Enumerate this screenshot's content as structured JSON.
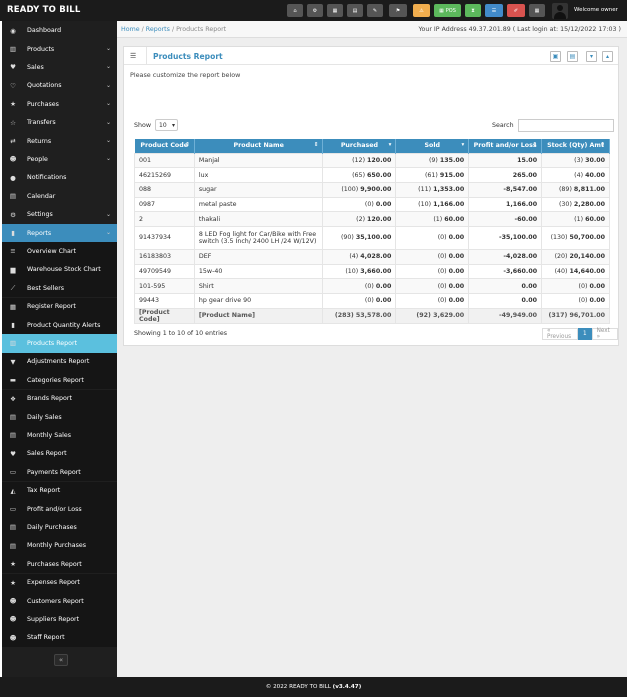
{
  "app": {
    "brand": "READY TO BILL",
    "welcome": "Welcome owner"
  },
  "toolbar": [
    {
      "icon": "home-icon",
      "glyph": "⌂",
      "color": "#555555",
      "label": ""
    },
    {
      "icon": "cogs-icon",
      "glyph": "⚙",
      "color": "#555555",
      "label": ""
    },
    {
      "icon": "calculator-icon",
      "glyph": "▦",
      "color": "#555555",
      "label": ""
    },
    {
      "icon": "calendar-icon",
      "glyph": "▤",
      "color": "#555555",
      "label": ""
    },
    {
      "icon": "notes-icon",
      "glyph": "✎",
      "color": "#555555",
      "label": ""
    },
    {
      "icon": "language-flag-icon",
      "glyph": "⚑",
      "color": "#555555",
      "label": ""
    },
    {
      "icon": "alert-icon",
      "glyph": "⚠",
      "color": "#f0ad4e",
      "label": ""
    },
    {
      "icon": "pos-icon",
      "glyph": "▦",
      "color": "#5cb85c",
      "label": "POS"
    },
    {
      "icon": "hourglass-icon",
      "glyph": "⧗",
      "color": "#5cb85c",
      "label": ""
    },
    {
      "icon": "list-icon",
      "glyph": "☰",
      "color": "#428bca",
      "label": ""
    },
    {
      "icon": "eraser-icon",
      "glyph": "✐",
      "color": "#d9534f",
      "label": ""
    },
    {
      "icon": "grid-icon",
      "glyph": "▦",
      "color": "#555555",
      "label": ""
    }
  ],
  "sidebar": {
    "items": [
      {
        "label": "Dashboard",
        "icon": "dashboard-icon",
        "glyph": "◉",
        "state": "normal",
        "chevron": false
      },
      {
        "label": "Products",
        "icon": "barcode-icon",
        "glyph": "▥",
        "state": "normal",
        "chevron": true
      },
      {
        "label": "Sales",
        "icon": "heart-icon",
        "glyph": "♥",
        "state": "normal",
        "chevron": true
      },
      {
        "label": "Quotations",
        "icon": "heart-outline-icon",
        "glyph": "♡",
        "state": "normal",
        "chevron": true
      },
      {
        "label": "Purchases",
        "icon": "star-icon",
        "glyph": "★",
        "state": "normal",
        "chevron": true
      },
      {
        "label": "Transfers",
        "icon": "star-outline-icon",
        "glyph": "☆",
        "state": "normal",
        "chevron": true
      },
      {
        "label": "Returns",
        "icon": "random-icon",
        "glyph": "⇄",
        "state": "normal",
        "chevron": true
      },
      {
        "label": "People",
        "icon": "users-icon",
        "glyph": "☻",
        "state": "normal",
        "chevron": true
      },
      {
        "label": "Notifications",
        "icon": "info-icon",
        "glyph": "●",
        "state": "normal",
        "chevron": false
      },
      {
        "label": "Calendar",
        "icon": "calendar-icon",
        "glyph": "▤",
        "state": "normal",
        "chevron": false
      },
      {
        "label": "Settings",
        "icon": "cog-icon",
        "glyph": "⚙",
        "state": "normal",
        "chevron": true
      },
      {
        "label": "Reports",
        "icon": "bar-chart-icon",
        "glyph": "▮",
        "state": "open",
        "chevron": true
      },
      {
        "label": "Overview Chart",
        "icon": "bars-icon",
        "glyph": "≡",
        "state": "sub",
        "chevron": false
      },
      {
        "label": "Warehouse Stock Chart",
        "icon": "building-icon",
        "glyph": "▆",
        "state": "sub",
        "chevron": false
      },
      {
        "label": "Best Sellers",
        "icon": "line-chart-icon",
        "glyph": "⟋",
        "state": "sub",
        "chevron": false
      },
      {
        "label": "Register Report",
        "icon": "th-icon",
        "glyph": "▦",
        "state": "sub",
        "chevron": false
      },
      {
        "label": "Product Quantity Alerts",
        "icon": "bar-chart-icon",
        "glyph": "▮",
        "state": "sub",
        "chevron": false
      },
      {
        "label": "Products Report",
        "icon": "barcode-icon",
        "glyph": "▥",
        "state": "active",
        "chevron": false
      },
      {
        "label": "Adjustments Report",
        "icon": "filter-icon",
        "glyph": "▼",
        "state": "sub",
        "chevron": false
      },
      {
        "label": "Categories Report",
        "icon": "folder-icon",
        "glyph": "▬",
        "state": "sub",
        "chevron": false
      },
      {
        "label": "Brands Report",
        "icon": "cubes-icon",
        "glyph": "❖",
        "state": "sub",
        "chevron": false
      },
      {
        "label": "Daily Sales",
        "icon": "calendar-icon",
        "glyph": "▤",
        "state": "sub",
        "chevron": false
      },
      {
        "label": "Monthly Sales",
        "icon": "calendar-icon",
        "glyph": "▤",
        "state": "sub",
        "chevron": false
      },
      {
        "label": "Sales Report",
        "icon": "heart-icon",
        "glyph": "♥",
        "state": "sub",
        "chevron": false
      },
      {
        "label": "Payments Report",
        "icon": "money-icon",
        "glyph": "▭",
        "state": "sub",
        "chevron": false
      },
      {
        "label": "Tax Report",
        "icon": "area-chart-icon",
        "glyph": "◭",
        "state": "sub",
        "chevron": false
      },
      {
        "label": "Profit and/or Loss",
        "icon": "money-icon",
        "glyph": "▭",
        "state": "sub",
        "chevron": false
      },
      {
        "label": "Daily Purchases",
        "icon": "calendar-icon",
        "glyph": "▤",
        "state": "sub",
        "chevron": false
      },
      {
        "label": "Monthly Purchases",
        "icon": "calendar-icon",
        "glyph": "▤",
        "state": "sub",
        "chevron": false
      },
      {
        "label": "Purchases Report",
        "icon": "star-icon",
        "glyph": "★",
        "state": "sub",
        "chevron": false
      },
      {
        "label": "Expenses Report",
        "icon": "star-icon",
        "glyph": "★",
        "state": "sub",
        "chevron": false
      },
      {
        "label": "Customers Report",
        "icon": "users-icon",
        "glyph": "☻",
        "state": "sub",
        "chevron": false
      },
      {
        "label": "Suppliers Report",
        "icon": "users-icon",
        "glyph": "☻",
        "state": "sub",
        "chevron": false
      },
      {
        "label": "Staff Report",
        "icon": "users-icon",
        "glyph": "☻",
        "state": "sub",
        "chevron": false
      }
    ],
    "collapse_glyph": "«"
  },
  "breadcrumb": {
    "home": "Home",
    "sep": "/",
    "reports": "Reports",
    "current": "Products Report"
  },
  "ip_info": "Your IP Address 49.37.201.89 ( Last login at: 15/12/2022 17:03 )",
  "box": {
    "title": "Products Report",
    "hint": "Please customize the report below"
  },
  "controls": {
    "show_label": "Show",
    "show_value": "10",
    "search_label": "Search"
  },
  "table": {
    "headers": [
      "Product Code",
      "Product Name",
      "Purchased",
      "Sold",
      "Profit and/or Loss",
      "Stock (Qty) Amt"
    ],
    "rows": [
      {
        "code": "001",
        "name": "Manjal",
        "purchased_qty": "(12)",
        "purchased_amt": "120.00",
        "sold_qty": "(9)",
        "sold_amt": "135.00",
        "profit": "15.00",
        "stock_qty": "(3)",
        "stock_amt": "30.00"
      },
      {
        "code": "46215269",
        "name": "lux",
        "purchased_qty": "(65)",
        "purchased_amt": "650.00",
        "sold_qty": "(61)",
        "sold_amt": "915.00",
        "profit": "265.00",
        "stock_qty": "(4)",
        "stock_amt": "40.00"
      },
      {
        "code": "088",
        "name": "sugar",
        "purchased_qty": "(100)",
        "purchased_amt": "9,900.00",
        "sold_qty": "(11)",
        "sold_amt": "1,353.00",
        "profit": "-8,547.00",
        "stock_qty": "(89)",
        "stock_amt": "8,811.00"
      },
      {
        "code": "0987",
        "name": "metal paste",
        "purchased_qty": "(0)",
        "purchased_amt": "0.00",
        "sold_qty": "(10)",
        "sold_amt": "1,166.00",
        "profit": "1,166.00",
        "stock_qty": "(30)",
        "stock_amt": "2,280.00"
      },
      {
        "code": "2",
        "name": "thakali",
        "purchased_qty": "(2)",
        "purchased_amt": "120.00",
        "sold_qty": "(1)",
        "sold_amt": "60.00",
        "profit": "-60.00",
        "stock_qty": "(1)",
        "stock_amt": "60.00"
      },
      {
        "code": "91437934",
        "name": "8 LED Fog light for Car/Bike with Free switch (3.5 Inch/ 2400 LH /24 W/12V)",
        "purchased_qty": "(90)",
        "purchased_amt": "35,100.00",
        "sold_qty": "(0)",
        "sold_amt": "0.00",
        "profit": "-35,100.00",
        "stock_qty": "(130)",
        "stock_amt": "50,700.00"
      },
      {
        "code": "16183803",
        "name": "DEF",
        "purchased_qty": "(4)",
        "purchased_amt": "4,028.00",
        "sold_qty": "(0)",
        "sold_amt": "0.00",
        "profit": "-4,028.00",
        "stock_qty": "(20)",
        "stock_amt": "20,140.00"
      },
      {
        "code": "49709549",
        "name": "15w-40",
        "purchased_qty": "(10)",
        "purchased_amt": "3,660.00",
        "sold_qty": "(0)",
        "sold_amt": "0.00",
        "profit": "-3,660.00",
        "stock_qty": "(40)",
        "stock_amt": "14,640.00"
      },
      {
        "code": "101-595",
        "name": "Shirt",
        "purchased_qty": "(0)",
        "purchased_amt": "0.00",
        "sold_qty": "(0)",
        "sold_amt": "0.00",
        "profit": "0.00",
        "stock_qty": "(0)",
        "stock_amt": "0.00"
      },
      {
        "code": "99443",
        "name": "hp gear drive 90",
        "purchased_qty": "(0)",
        "purchased_amt": "0.00",
        "sold_qty": "(0)",
        "sold_amt": "0.00",
        "profit": "0.00",
        "stock_qty": "(0)",
        "stock_amt": "0.00"
      }
    ],
    "footer": {
      "code": "[Product Code]",
      "name": "[Product Name]",
      "purchased": "(283) 53,578.00",
      "sold": "(92) 3,629.00",
      "profit": "-49,949.00",
      "stock": "(317) 96,701.00"
    }
  },
  "entries_info": "Showing 1 to 10 of 10 entries",
  "pagination": {
    "prev": "« Previous",
    "page": "1",
    "next": "Next »"
  },
  "footer": {
    "text": "© 2022 READY TO BILL",
    "version": "(v3.4.47)"
  },
  "colors": {
    "accent": "#3c8dbc",
    "active": "#5bc0de",
    "sidebar": "#1f1f1f",
    "topbar": "#1b1b1b"
  }
}
